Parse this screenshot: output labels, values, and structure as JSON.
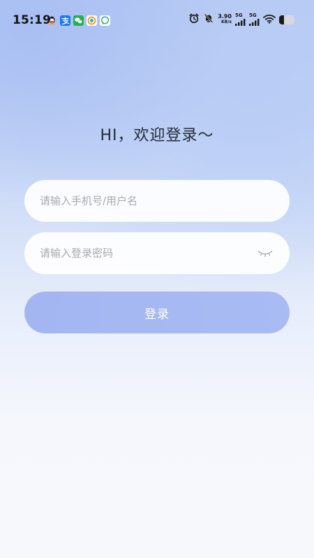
{
  "status_bar": {
    "time": "15:19",
    "net_speed": "3.90",
    "net_speed_unit": "KB/s",
    "sim1_label": "5G",
    "sim2_label": "5G",
    "battery_level": 0.3,
    "notification_icons": [
      "qq-icon",
      "alipay-icon",
      "wechat-icon",
      "browser-icon",
      "message-bubble-icon"
    ],
    "status_icons": [
      "alarm-icon",
      "mute-bell-icon",
      "signal-icon",
      "signal-icon",
      "wifi-icon",
      "battery-icon"
    ]
  },
  "login": {
    "title": "HI，欢迎登录～",
    "account_placeholder": "请输入手机号/用户名",
    "account_value": "",
    "password_placeholder": "请输入登录密码",
    "password_value": "",
    "password_toggle_icon": "eye-closed-icon",
    "submit_label": "登录"
  },
  "colors": {
    "accent": "#a6b8f2",
    "background_top": "#b6c9f4",
    "background_bottom": "#f7f8fc",
    "title_text": "#242a36",
    "placeholder_text": "#a8aab0"
  }
}
